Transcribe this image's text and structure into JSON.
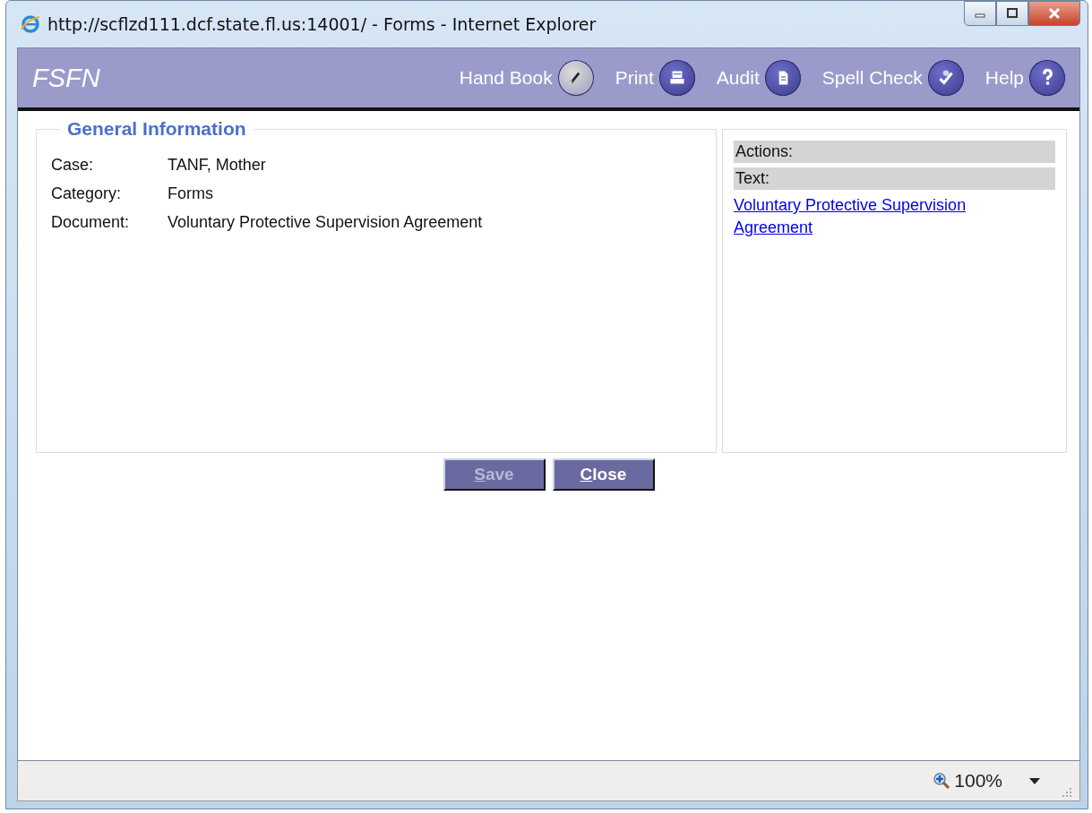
{
  "window": {
    "title": "http://scflzd111.dcf.state.fl.us:14001/ - Forms - Internet Explorer"
  },
  "header": {
    "logo": "FSFN",
    "tools": [
      {
        "label": "Hand Book",
        "kind": "pen"
      },
      {
        "label": "Print",
        "kind": "print"
      },
      {
        "label": "Audit",
        "kind": "doc"
      },
      {
        "label": "Spell Check",
        "kind": "spell"
      },
      {
        "label": "Help",
        "kind": "help"
      }
    ]
  },
  "general_information": {
    "title": "General Information",
    "fields": [
      {
        "label": "Case:",
        "value": "TANF, Mother"
      },
      {
        "label": "Category:",
        "value": "Forms"
      },
      {
        "label": "Document:",
        "value": "Voluntary Protective Supervision Agreement"
      }
    ]
  },
  "side_panel": {
    "sections": [
      "Actions:",
      "Text:"
    ],
    "link": "Voluntary Protective Supervision Agreement"
  },
  "buttons": [
    {
      "label": "Save",
      "disabled": true
    },
    {
      "label": "Close",
      "disabled": false
    }
  ],
  "status_bar": {
    "zoom": "100%"
  }
}
